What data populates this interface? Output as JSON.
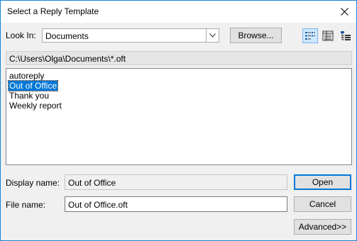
{
  "window": {
    "title": "Select a Reply Template"
  },
  "look_in": {
    "label": "Look In:",
    "value": "Documents"
  },
  "buttons": {
    "browse": "Browse...",
    "open": "Open",
    "cancel": "Cancel",
    "advanced": "Advanced>>"
  },
  "view_buttons": [
    "list-view-icon",
    "details-view-icon",
    "properties-view-icon"
  ],
  "path": "C:\\Users\\Olga\\Documents\\*.oft",
  "files": [
    {
      "name": "autoreply",
      "selected": false
    },
    {
      "name": "Out of Office",
      "selected": true
    },
    {
      "name": "Thank you",
      "selected": false
    },
    {
      "name": "Weekly report",
      "selected": false
    }
  ],
  "display_name": {
    "label": "Display name:",
    "value": "Out of Office"
  },
  "file_name": {
    "label": "File name:",
    "value": "Out of Office.oft"
  },
  "colors": {
    "accent": "#0078d7",
    "window_border": "#1883d7",
    "background": "#f0f0f0"
  }
}
